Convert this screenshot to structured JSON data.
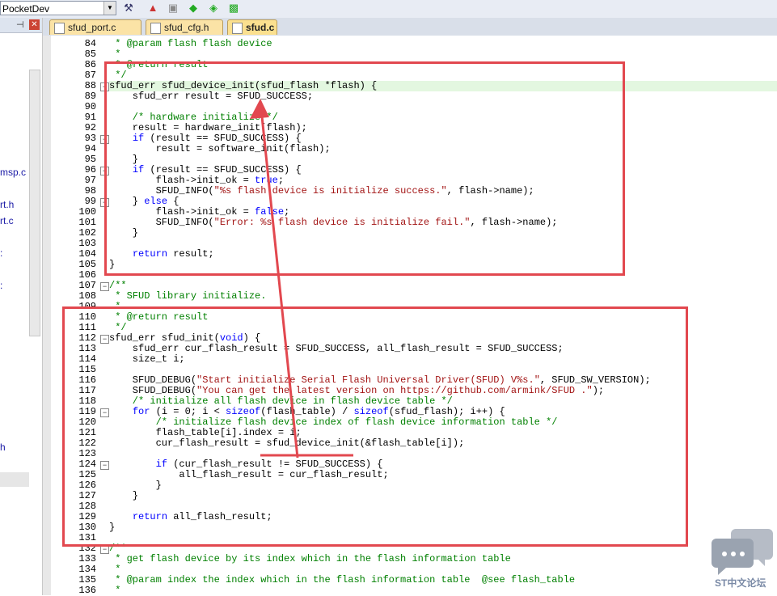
{
  "toolbar": {
    "project_combo": "PocketDev",
    "buttons": [
      "build-icon",
      "tool1-icon",
      "tool2-icon",
      "tool3-icon",
      "tool4-icon",
      "tool5-icon"
    ]
  },
  "left_pane": {
    "items": [
      {
        "label": "msp.c"
      },
      {
        "label": "rt.h"
      },
      {
        "label": "rt.c"
      },
      {
        "label": ":"
      },
      {
        "label": ":"
      },
      {
        "label": "h"
      }
    ]
  },
  "tabs": [
    {
      "label": "sfud_port.c",
      "active": false
    },
    {
      "label": "sfud_cfg.h",
      "active": false
    },
    {
      "label": "sfud.c",
      "active": true
    }
  ],
  "code": {
    "lines": [
      {
        "n": "84",
        "fold": "",
        "text": " * @param flash flash device",
        "type": "cm"
      },
      {
        "n": "85",
        "fold": "",
        "text": " *",
        "type": "cm"
      },
      {
        "n": "86",
        "fold": "",
        "text": " * @return result",
        "type": "cm"
      },
      {
        "n": "87",
        "fold": "",
        "text": " */",
        "type": "cm"
      },
      {
        "n": "88",
        "fold": "-",
        "text": "sfud_err sfud_device_init(sfud_flash *flash) {",
        "type": "code"
      },
      {
        "n": "89",
        "fold": "",
        "text": "    sfud_err result = SFUD_SUCCESS;",
        "type": "code"
      },
      {
        "n": "90",
        "fold": "",
        "text": "",
        "type": "code"
      },
      {
        "n": "91",
        "fold": "",
        "text": "    /* hardware initialize */",
        "type": "cm"
      },
      {
        "n": "92",
        "fold": "",
        "text": "    result = hardware_init(flash);",
        "type": "code"
      },
      {
        "n": "93",
        "fold": "-",
        "text": "    if (result == SFUD_SUCCESS) {",
        "type": "code"
      },
      {
        "n": "94",
        "fold": "",
        "text": "        result = software_init(flash);",
        "type": "code"
      },
      {
        "n": "95",
        "fold": "",
        "text": "    }",
        "type": "code"
      },
      {
        "n": "96",
        "fold": "-",
        "text": "    if (result == SFUD_SUCCESS) {",
        "type": "code"
      },
      {
        "n": "97",
        "fold": "",
        "text": "        flash->init_ok = true;",
        "type": "code"
      },
      {
        "n": "98",
        "fold": "",
        "text": "        SFUD_INFO(\"%s flash device is initialize success.\", flash->name);",
        "type": "code"
      },
      {
        "n": "99",
        "fold": "-",
        "text": "    } else {",
        "type": "code"
      },
      {
        "n": "100",
        "fold": "",
        "text": "        flash->init_ok = false;",
        "type": "code"
      },
      {
        "n": "101",
        "fold": "",
        "text": "        SFUD_INFO(\"Error: %s flash device is initialize fail.\", flash->name);",
        "type": "code"
      },
      {
        "n": "102",
        "fold": "",
        "text": "    }",
        "type": "code"
      },
      {
        "n": "103",
        "fold": "",
        "text": "",
        "type": "code"
      },
      {
        "n": "104",
        "fold": "",
        "text": "    return result;",
        "type": "code"
      },
      {
        "n": "105",
        "fold": "",
        "text": "}",
        "type": "code"
      },
      {
        "n": "106",
        "fold": "",
        "text": "",
        "type": "code"
      },
      {
        "n": "107",
        "fold": "-",
        "text": "/**",
        "type": "cm"
      },
      {
        "n": "108",
        "fold": "",
        "text": " * SFUD library initialize.",
        "type": "cm"
      },
      {
        "n": "109",
        "fold": "",
        "text": " *",
        "type": "cm"
      },
      {
        "n": "110",
        "fold": "",
        "text": " * @return result",
        "type": "cm"
      },
      {
        "n": "111",
        "fold": "",
        "text": " */",
        "type": "cm"
      },
      {
        "n": "112",
        "fold": "-",
        "text": "sfud_err sfud_init(void) {",
        "type": "code"
      },
      {
        "n": "113",
        "fold": "",
        "text": "    sfud_err cur_flash_result = SFUD_SUCCESS, all_flash_result = SFUD_SUCCESS;",
        "type": "code"
      },
      {
        "n": "114",
        "fold": "",
        "text": "    size_t i;",
        "type": "code"
      },
      {
        "n": "115",
        "fold": "",
        "text": "",
        "type": "code"
      },
      {
        "n": "116",
        "fold": "",
        "text": "    SFUD_DEBUG(\"Start initialize Serial Flash Universal Driver(SFUD) V%s.\", SFUD_SW_VERSION);",
        "type": "code"
      },
      {
        "n": "117",
        "fold": "",
        "text": "    SFUD_DEBUG(\"You can get the latest version on https://github.com/armink/SFUD .\");",
        "type": "code"
      },
      {
        "n": "118",
        "fold": "",
        "text": "    /* initialize all flash device in flash device table */",
        "type": "cm"
      },
      {
        "n": "119",
        "fold": "-",
        "text": "    for (i = 0; i < sizeof(flash_table) / sizeof(sfud_flash); i++) {",
        "type": "code"
      },
      {
        "n": "120",
        "fold": "",
        "text": "        /* initialize flash device index of flash device information table */",
        "type": "cm"
      },
      {
        "n": "121",
        "fold": "",
        "text": "        flash_table[i].index = i;",
        "type": "code"
      },
      {
        "n": "122",
        "fold": "",
        "text": "        cur_flash_result = sfud_device_init(&flash_table[i]);",
        "type": "code"
      },
      {
        "n": "123",
        "fold": "",
        "text": "",
        "type": "code"
      },
      {
        "n": "124",
        "fold": "-",
        "text": "        if (cur_flash_result != SFUD_SUCCESS) {",
        "type": "code"
      },
      {
        "n": "125",
        "fold": "",
        "text": "            all_flash_result = cur_flash_result;",
        "type": "code"
      },
      {
        "n": "126",
        "fold": "",
        "text": "        }",
        "type": "code"
      },
      {
        "n": "127",
        "fold": "",
        "text": "    }",
        "type": "code"
      },
      {
        "n": "128",
        "fold": "",
        "text": "",
        "type": "code"
      },
      {
        "n": "129",
        "fold": "",
        "text": "    return all_flash_result;",
        "type": "code"
      },
      {
        "n": "130",
        "fold": "",
        "text": "}",
        "type": "code"
      },
      {
        "n": "131",
        "fold": "",
        "text": "",
        "type": "code"
      },
      {
        "n": "132",
        "fold": "-",
        "text": "/**",
        "type": "cm"
      },
      {
        "n": "133",
        "fold": "",
        "text": " * get flash device by its index which in the flash information table",
        "type": "cm"
      },
      {
        "n": "134",
        "fold": "",
        "text": " *",
        "type": "cm"
      },
      {
        "n": "135",
        "fold": "",
        "text": " * @param index the index which in the flash information table  @see flash_table",
        "type": "cm"
      },
      {
        "n": "136",
        "fold": "",
        "text": " *",
        "type": "cm"
      }
    ]
  },
  "watermark": {
    "text": "ST中文论坛"
  },
  "colors": {
    "annotation_red": "#e2484f",
    "keyword": "#0000ff",
    "comment": "#008000",
    "string": "#a31515"
  }
}
